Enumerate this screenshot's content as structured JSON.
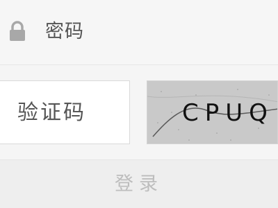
{
  "password_row": {
    "icon": "lock-icon",
    "label": "密码"
  },
  "captcha": {
    "placeholder": "验证码",
    "code": "CPUQ"
  },
  "login": {
    "label": "登录"
  },
  "colors": {
    "background": "#f5f5f5",
    "label_text": "#555555",
    "disabled_button_text": "#bdbdbd",
    "captcha_bg": "#c9c9c9"
  }
}
